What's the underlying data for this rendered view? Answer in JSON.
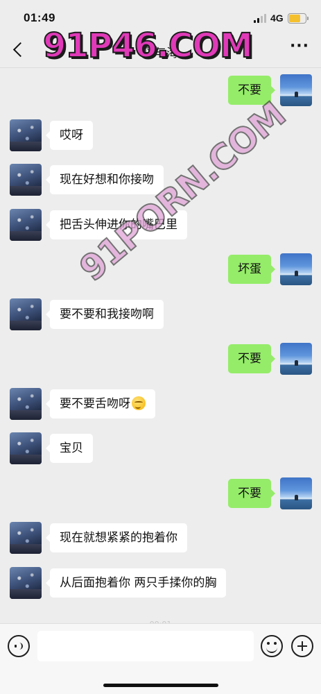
{
  "status_bar": {
    "time": "01:49",
    "network": "4G",
    "battery_color": "#f5c02e"
  },
  "header": {
    "title": "丹与海",
    "back_icon": "chevron-left-icon",
    "more_icon": "more-dots-icon",
    "more_label": "···"
  },
  "watermarks": {
    "top": "91P46.COM",
    "diagonal": "91PORN.COM"
  },
  "messages": [
    {
      "side": "right",
      "text": "不要"
    },
    {
      "side": "left",
      "text": "哎呀"
    },
    {
      "side": "left",
      "text": "现在好想和你接吻"
    },
    {
      "side": "left",
      "text": "把舌头伸进你的嘴巴里"
    },
    {
      "side": "right",
      "text": "坏蛋"
    },
    {
      "side": "left",
      "text": "要不要和我接吻啊"
    },
    {
      "side": "right",
      "text": "不要"
    },
    {
      "side": "left",
      "text": "要不要舌吻呀",
      "emoji": "hugging-face-emoji"
    },
    {
      "side": "left",
      "text": "宝贝"
    },
    {
      "side": "right",
      "text": "不要"
    },
    {
      "side": "left",
      "text": "现在就想紧紧的抱着你"
    },
    {
      "side": "left",
      "text": "从后面抱着你 两只手揉你的胸"
    }
  ],
  "timestamp": "00:01",
  "input_bar": {
    "placeholder": "",
    "value": "",
    "voice_icon": "voice-icon",
    "emoji_icon": "emoji-icon",
    "plus_icon": "plus-icon"
  },
  "colors": {
    "sent_bubble": "#95ec69",
    "received_bubble": "#ffffff",
    "background": "#ededed"
  }
}
